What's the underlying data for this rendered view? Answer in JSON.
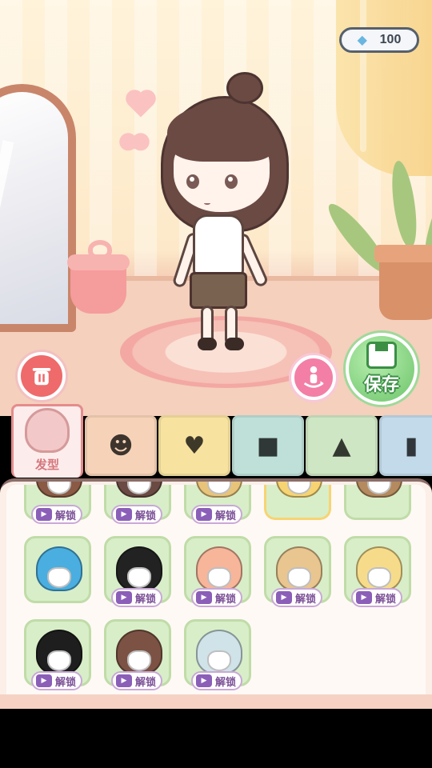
{
  "currency": {
    "icon": "diamond-icon",
    "value": "100"
  },
  "buttons": {
    "save_label": "保存"
  },
  "tabs": [
    {
      "id": "hairstyle",
      "label": "发型",
      "active": true,
      "icon": "hairstyle-icon",
      "color": "#fdecec"
    },
    {
      "id": "face",
      "label": "",
      "icon": "face-icon",
      "color": "#f6d3b8"
    },
    {
      "id": "top",
      "label": "",
      "icon": "shirt-icon",
      "color": "#f7e2a0"
    },
    {
      "id": "bottom",
      "label": "",
      "icon": "shorts-icon",
      "color": "#bfe0d8"
    },
    {
      "id": "dress",
      "label": "",
      "icon": "dress-icon",
      "color": "#cfe6c4"
    },
    {
      "id": "shoes",
      "label": "",
      "icon": "boot-icon",
      "color": "#c2daea"
    }
  ],
  "items": {
    "unlock_label": "解锁",
    "row0": [
      {
        "hair": "#8a5a44",
        "locked": true
      },
      {
        "hair": "#6b4a44",
        "locked": true
      },
      {
        "hair": "#e8c47a",
        "locked": true
      },
      {
        "hair": "#f7d472",
        "locked": false,
        "selected": true
      },
      {
        "hair": "#b48a5e",
        "locked": false
      }
    ],
    "row1": [
      {
        "hair": "#4aaee0",
        "locked": false
      },
      {
        "hair": "#222222",
        "locked": true
      },
      {
        "hair": "#f7b59a",
        "locked": true
      },
      {
        "hair": "#e9c58f",
        "locked": true
      },
      {
        "hair": "#f6dc8a",
        "locked": true
      }
    ],
    "row2": [
      {
        "hair": "#1e1e1e",
        "locked": true
      },
      {
        "hair": "#7b5244",
        "locked": true
      },
      {
        "hair": "#cfe3e8",
        "locked": true
      }
    ]
  }
}
